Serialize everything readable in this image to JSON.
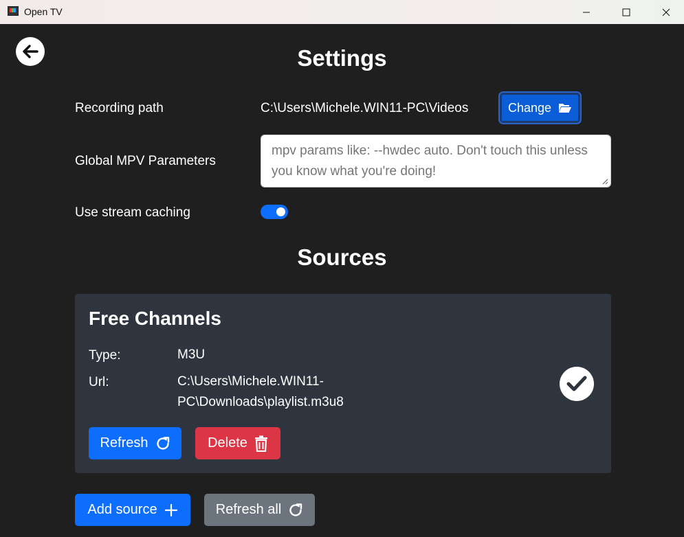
{
  "window": {
    "title": "Open TV"
  },
  "settings": {
    "heading": "Settings",
    "recording_path_label": "Recording path",
    "recording_path_value": "C:\\Users\\Michele.WIN11-PC\\Videos",
    "change_label": "Change",
    "mpv_label": "Global MPV Parameters",
    "mpv_placeholder": "mpv params like: --hwdec auto. Don't touch this unless you know what you're doing!",
    "mpv_value": "",
    "caching_label": "Use stream caching",
    "caching_enabled": true
  },
  "sources": {
    "heading": "Sources",
    "items": [
      {
        "name": "Free Channels",
        "type_label": "Type:",
        "type_value": "M3U",
        "url_label": "Url:",
        "url_value": "C:\\Users\\Michele.WIN11-PC\\Downloads\\playlist.m3u8",
        "refresh_label": "Refresh",
        "delete_label": "Delete",
        "selected": true
      }
    ],
    "add_label": "Add source",
    "refresh_all_label": "Refresh all"
  },
  "colors": {
    "primary": "#0d6efd",
    "danger": "#dc3545",
    "secondary": "#6c757d",
    "background": "#1f1f1f",
    "card": "#2f353e"
  }
}
